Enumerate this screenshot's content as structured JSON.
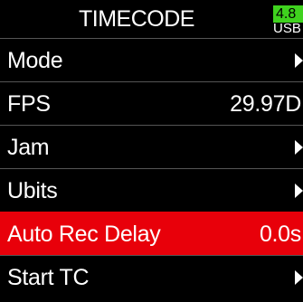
{
  "header": {
    "title": "TIMECODE",
    "battery_level": "4.8",
    "battery_label": "USB"
  },
  "menu": {
    "items": [
      {
        "label": "Mode",
        "value": null,
        "has_arrow": true,
        "selected": false
      },
      {
        "label": "FPS",
        "value": "29.97D",
        "has_arrow": false,
        "selected": false
      },
      {
        "label": "Jam",
        "value": null,
        "has_arrow": true,
        "selected": false
      },
      {
        "label": "Ubits",
        "value": null,
        "has_arrow": true,
        "selected": false
      },
      {
        "label": "Auto Rec Delay",
        "value": "0.0s",
        "has_arrow": false,
        "selected": true
      },
      {
        "label": "Start TC",
        "value": null,
        "has_arrow": true,
        "selected": false
      }
    ]
  },
  "colors": {
    "background": "#000000",
    "text": "#ffffff",
    "selected_row": "#e8000a",
    "battery": "#3fd21e"
  },
  "icons": {
    "submenu_arrow": "triangle-right-icon",
    "battery": "battery-icon"
  }
}
